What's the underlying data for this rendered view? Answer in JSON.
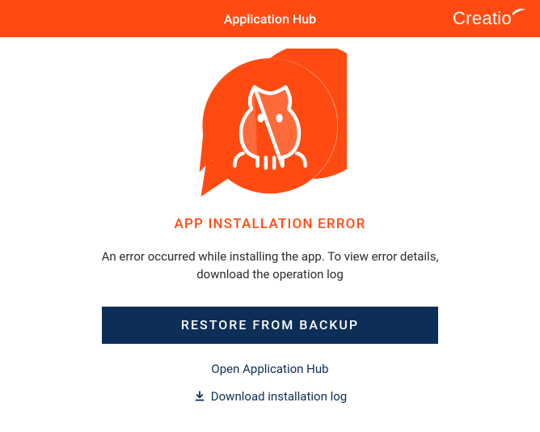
{
  "header": {
    "title": "Application Hub",
    "logo_text": "Creatio"
  },
  "error": {
    "title": "APP INSTALLATION ERROR",
    "description": "An error occurred while installing the app. To view error details, download the operation log"
  },
  "actions": {
    "restore_label": "RESTORE FROM BACKUP",
    "open_hub_label": "Open Application Hub",
    "download_log_label": "Download installation log"
  },
  "colors": {
    "accent": "#ff4b12",
    "primary_dark": "#0d2e57"
  }
}
